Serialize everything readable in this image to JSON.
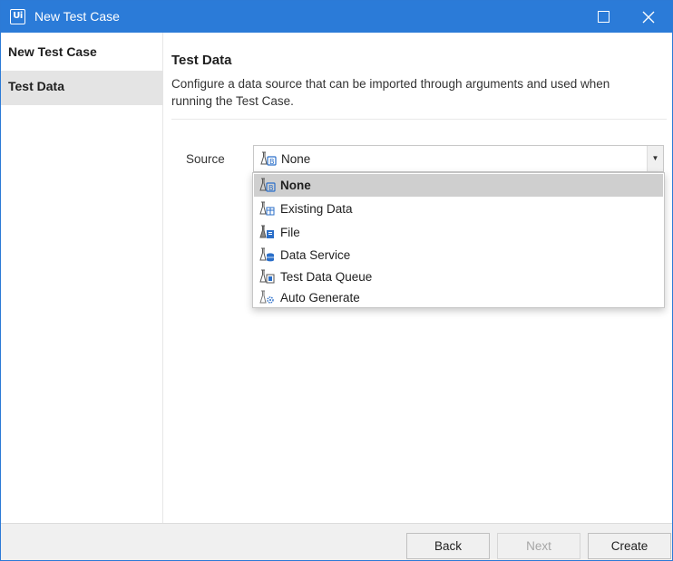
{
  "window": {
    "app_icon_text": "Ui",
    "title": "New Test Case"
  },
  "sidebar": {
    "items": [
      {
        "label": "New Test Case",
        "active": false
      },
      {
        "label": "Test Data",
        "active": true
      }
    ]
  },
  "main": {
    "title": "Test Data",
    "description": "Configure a data source that can be imported through arguments and used when running the Test Case.",
    "source_label": "Source",
    "source_value": "None"
  },
  "dropdown": {
    "options": [
      {
        "label": "None",
        "icon": "flask-data-icon",
        "selected": true
      },
      {
        "label": "Existing Data",
        "icon": "flask-table-icon",
        "selected": false
      },
      {
        "label": "File",
        "icon": "flask-file-icon",
        "selected": false
      },
      {
        "label": "Data Service",
        "icon": "flask-database-icon",
        "selected": false
      },
      {
        "label": "Test Data Queue",
        "icon": "flask-queue-icon",
        "selected": false
      },
      {
        "label": "Auto Generate",
        "icon": "flask-gear-icon",
        "selected": false
      }
    ]
  },
  "footer": {
    "back_label": "Back",
    "next_label": "Next",
    "create_label": "Create"
  },
  "colors": {
    "titlebar": "#2b7bd8",
    "selected_option": "#cfcfcf",
    "active_sidebar": "#e4e4e4",
    "icon_accent": "#2b6fc9"
  }
}
